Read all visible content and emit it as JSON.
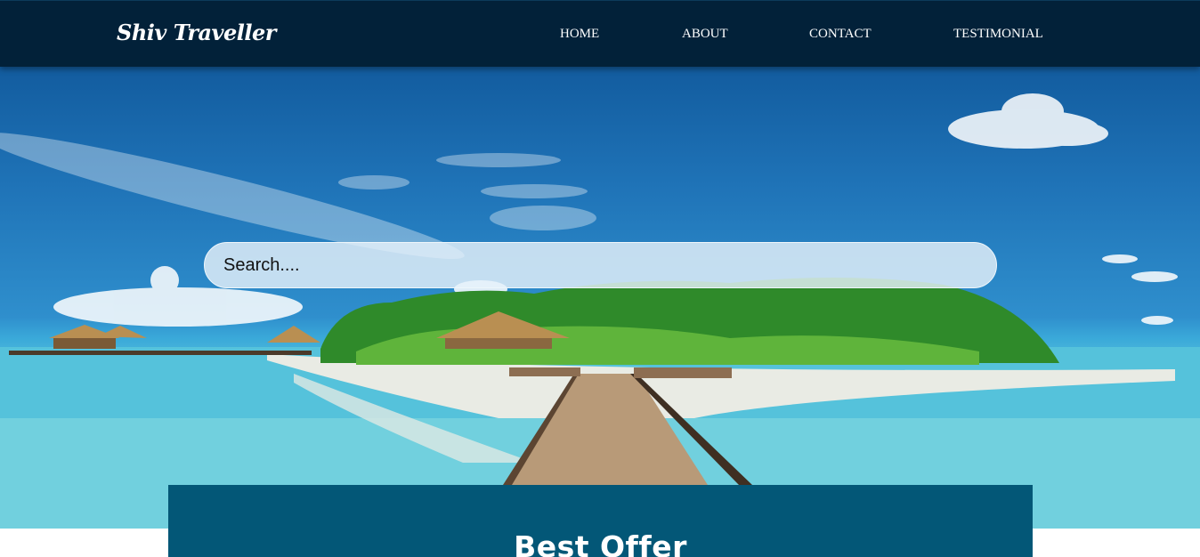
{
  "brand": {
    "name": "Shiv Traveller"
  },
  "nav": {
    "items": [
      "HOME",
      "ABOUT",
      "CONTACT",
      "TESTIMONIAL"
    ]
  },
  "search": {
    "placeholder": "Search...."
  },
  "offer": {
    "title": "Best Offer"
  },
  "colors": {
    "navbar": "#022139",
    "offer_panel": "#035777",
    "sky": "#1f73b7",
    "sea": "#64c9dc"
  }
}
